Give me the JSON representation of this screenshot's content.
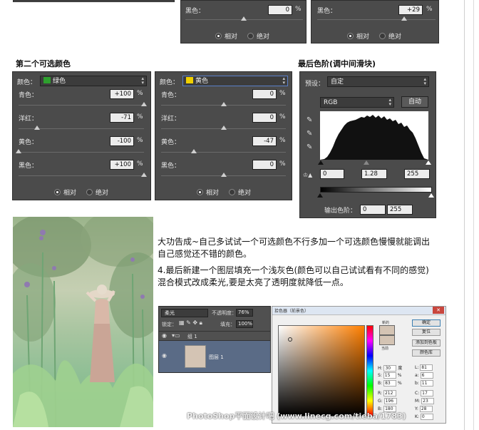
{
  "top_partial": {
    "left": {
      "label": "黑色：",
      "value": "0",
      "pct": "%",
      "radio_rel": "相对",
      "radio_abs": "绝对"
    },
    "right": {
      "label": "黑色：",
      "value": "+29",
      "pct": "%",
      "radio_rel": "相对",
      "radio_abs": "绝对"
    }
  },
  "headings": {
    "second_selective": "第二个可选颜色",
    "final_levels": "最后色阶(调中间滑块)"
  },
  "panel_green": {
    "color_label": "颜色：",
    "color_name": "绿色",
    "swatch": "#2ea02e",
    "rows": [
      {
        "label": "青色：",
        "value": "+100",
        "pct": "%",
        "pos": 1.0
      },
      {
        "label": "洋红：",
        "value": "-71",
        "pct": "%",
        "pos": 0.145
      },
      {
        "label": "黄色：",
        "value": "-100",
        "pct": "%",
        "pos": 0.0
      },
      {
        "label": "黑色：",
        "value": "+100",
        "pct": "%",
        "pos": 1.0
      }
    ],
    "radio_rel": "相对",
    "radio_abs": "绝对"
  },
  "panel_yellow": {
    "color_label": "颜色：",
    "color_name": "黄色",
    "swatch": "#f0d000",
    "rows": [
      {
        "label": "青色：",
        "value": "0",
        "pct": "%",
        "pos": 0.5
      },
      {
        "label": "洋红：",
        "value": "0",
        "pct": "%",
        "pos": 0.5
      },
      {
        "label": "黄色：",
        "value": "-47",
        "pct": "%",
        "pos": 0.265
      },
      {
        "label": "黑色：",
        "value": "0",
        "pct": "%",
        "pos": 0.5
      }
    ],
    "radio_rel": "相对",
    "radio_abs": "绝对"
  },
  "levels_panel": {
    "preset_label": "预设：",
    "preset_value": "自定",
    "channel": "RGB",
    "auto_button": "自动",
    "input_black": "0",
    "input_mid": "1.28",
    "input_white": "255",
    "output_label": "输出色阶：",
    "output_black": "0",
    "output_white": "255"
  },
  "body_text": {
    "p1": "大功告成~自己多试试一个可选颜色不行多加一个可选颜色慢慢就能调出自己感觉还不错的颜色。",
    "p2": "4.最后新建一个图层填充一个浅灰色(颜色可以自己试试看有不同的感觉)混合模式改成柔光,要是太亮了透明度就降低一点。"
  },
  "layers_panel": {
    "blend_mode": "柔光",
    "opacity_label": "不透明度：",
    "opacity_value": "76%",
    "lock_label": "锁定：",
    "fill_label": "填充：",
    "fill_value": "100%",
    "group_name": "组 1",
    "layer_name": "图层 1",
    "layer_color": "#d4c4b4"
  },
  "color_picker": {
    "tabs": "拾色器（前景色）",
    "ok": "确定",
    "reset": "复位",
    "add_swatch": "添加到色板",
    "libraries": "颜色库",
    "new_label": "新的",
    "current_label": "当前",
    "fields": [
      {
        "k": "H:",
        "v": "30",
        "u": "度"
      },
      {
        "k": "S:",
        "v": "15",
        "u": "%"
      },
      {
        "k": "B:",
        "v": "83",
        "u": "%"
      },
      {
        "k": "R:",
        "v": "212",
        "u": ""
      },
      {
        "k": "G:",
        "v": "196",
        "u": ""
      },
      {
        "k": "B:",
        "v": "180",
        "u": ""
      }
    ],
    "lab": [
      {
        "k": "L:",
        "v": "81"
      },
      {
        "k": "a:",
        "v": "6"
      },
      {
        "k": "b:",
        "v": "11"
      },
      {
        "k": "C:",
        "v": "17"
      },
      {
        "k": "M:",
        "v": "23"
      },
      {
        "k": "Y:",
        "v": "28"
      },
      {
        "k": "K:",
        "v": "0"
      }
    ]
  },
  "watermark": "PhotoShop平面设计吧 (www.linecg.com/tieba/1783)"
}
